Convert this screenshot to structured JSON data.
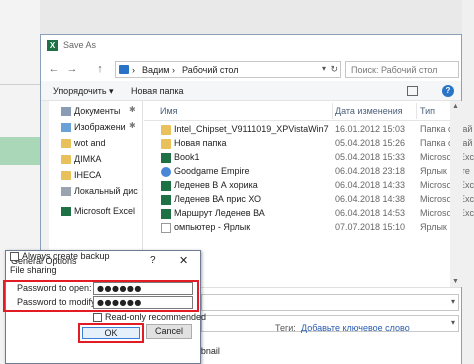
{
  "saveas": {
    "title": "Save As",
    "nav_back": "←",
    "nav_forward": "→",
    "nav_up": "↑",
    "address": {
      "pc_icon": "computer-icon",
      "sep1": "›",
      "crumb1": "Вадим",
      "sep2": "›",
      "crumb2": "Рабочий стол",
      "dropdown": "▾",
      "refresh": "↻"
    },
    "search_placeholder": "Поиск: Рабочий стол",
    "toolbar": {
      "organize": "Упорядочить ▾",
      "new_folder": "Новая папка"
    },
    "nav_items": [
      {
        "label": "Документы",
        "icon": "documents-icon",
        "pinned": true
      },
      {
        "label": "Изображени",
        "icon": "images-icon",
        "pinned": true
      },
      {
        "label": "wot and",
        "icon": "folder-icon",
        "pinned": false
      },
      {
        "label": "ДІМКА",
        "icon": "folder-icon",
        "pinned": false
      },
      {
        "label": "ІНЕСА",
        "icon": "folder-icon",
        "pinned": false
      },
      {
        "label": "Локальный дис",
        "icon": "drive-icon",
        "pinned": false
      },
      {
        "label": "Microsoft Excel",
        "icon": "excel-icon",
        "pinned": false
      }
    ],
    "columns": {
      "name": "Имя",
      "date": "Дата изменения",
      "type": "Тип"
    },
    "files": [
      {
        "name": "Intel_Chipset_V9111019_XPVistaWin7",
        "date": "16.01.2012 15:03",
        "type": "Папка с фай",
        "icon": "folder"
      },
      {
        "name": "Новая папка",
        "date": "05.04.2018 15:26",
        "type": "Папка с фай",
        "icon": "folder"
      },
      {
        "name": "Book1",
        "date": "05.04.2018 15:33",
        "type": "Microsoft Exc",
        "icon": "xlsx"
      },
      {
        "name": "Goodgame Empire",
        "date": "06.04.2018 23:18",
        "type": "Ярлык Инте",
        "icon": "game"
      },
      {
        "name": "Леденев В А хорика",
        "date": "06.04.2018 14:33",
        "type": "Microsoft Exc",
        "icon": "xlsx"
      },
      {
        "name": "Леденев ВА прис ХО",
        "date": "06.04.2018 14:38",
        "type": "Microsoft Exc",
        "icon": "xlsx"
      },
      {
        "name": "Маршрут Леденев ВА",
        "date": "06.04.2018 14:53",
        "type": "Microsoft Exc",
        "icon": "xlsx"
      },
      {
        "name": "омпьютер - Ярлык",
        "date": "07.07.2018 15:10",
        "type": "Ярлык",
        "icon": "doc"
      }
    ],
    "tags_label": "Теги:",
    "tags_link": "Добавьте ключевое слово",
    "save_thumbnail": "Save Thumbnail"
  },
  "dialog": {
    "title": "General Options",
    "help": "?",
    "close": "✕",
    "always_backup": "Always create backup",
    "file_sharing": "File sharing",
    "password_open_label": "Password to open:",
    "password_open_value": "●●●●●●",
    "password_modify_label": "Password to modify:",
    "password_modify_value": "●●●●●●",
    "read_only": "Read-only recommended",
    "ok": "OK",
    "cancel": "Cancel"
  },
  "colors": {
    "highlight": "#e11c24",
    "excel_green": "#1e7145",
    "folder": "#e8c15a",
    "accent": "#2a74c8"
  }
}
